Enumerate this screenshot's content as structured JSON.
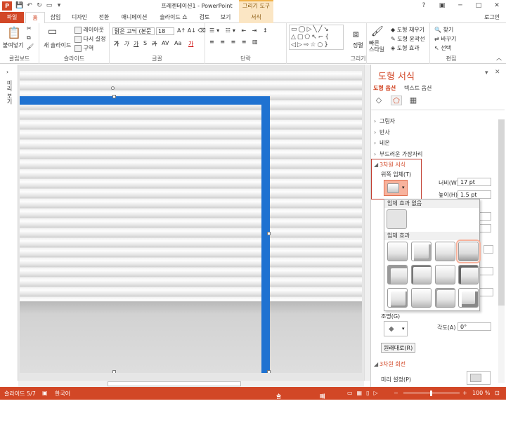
{
  "title_bar": {
    "window_title": "프레젠테이션1 - PowerPoint",
    "context_group": "그리기 도구",
    "login": "로그인",
    "app_logo": "P"
  },
  "tabs": {
    "file": "파일",
    "home": "홈",
    "insert": "삽입",
    "design": "디자인",
    "transitions": "전환",
    "animations": "애니메이션",
    "slideshow": "슬라이드 쇼",
    "review": "검토",
    "view": "보기",
    "format": "서식"
  },
  "ribbon": {
    "clipboard": {
      "label": "클립보드",
      "paste": "붙여넣기"
    },
    "slides": {
      "label": "슬라이드",
      "new_slide": "새 슬라이드",
      "layout": "레이아웃",
      "reset": "다시 설정",
      "section": "구역"
    },
    "font": {
      "label": "글꼴",
      "font_name": "맑은 고딕 (본문",
      "font_size": "18",
      "bold": "가",
      "italic": "가",
      "underline": "가",
      "strike": "가",
      "shadow": "S",
      "spacing": "AV",
      "case": "Aa",
      "color": "가"
    },
    "paragraph": {
      "label": "단락"
    },
    "drawing": {
      "label": "그리기",
      "arrange": "정렬",
      "quick_styles": "빠른\n스타일",
      "shape_fill": "도형 채우기",
      "shape_outline": "도형 윤곽선",
      "shape_effects": "도형 효과"
    },
    "editing": {
      "label": "편집",
      "find": "찾기",
      "replace": "바꾸기",
      "select": "선택"
    }
  },
  "left_panel": {
    "label": "미리 보기"
  },
  "format_pane": {
    "title": "도형 서식",
    "tab_shape": "도형 옵션",
    "tab_text": "텍스트 옵션",
    "sections": {
      "shadow": "그림자",
      "reflection": "반사",
      "glow": "네온",
      "soft_edges": "부드러운 가장자리",
      "format_3d": "3차원 서식",
      "rotation_3d": "3차원 회전"
    },
    "top_bevel": "위쪽 입체(T)",
    "width_label": "너비(W)",
    "width_value": "17 pt",
    "height_label": "높이(H)",
    "height_value": "1.5 pt",
    "lighting": "조명(G)",
    "angle_label": "각도(A)",
    "angle_value": "0°",
    "reset_button": "원래대로(R)",
    "preset": "미리 설정(P)",
    "gallery": {
      "no_bevel": "입체 효과 없음",
      "bevel": "입체 효과"
    }
  },
  "status": {
    "slide": "슬라이드 5/7",
    "language": "한국어",
    "notes": "슬라이드 노트",
    "comments": "메모",
    "zoom": "100 %"
  },
  "colors": {
    "accent": "#D24726",
    "shape_blue": "#1F72D1"
  }
}
